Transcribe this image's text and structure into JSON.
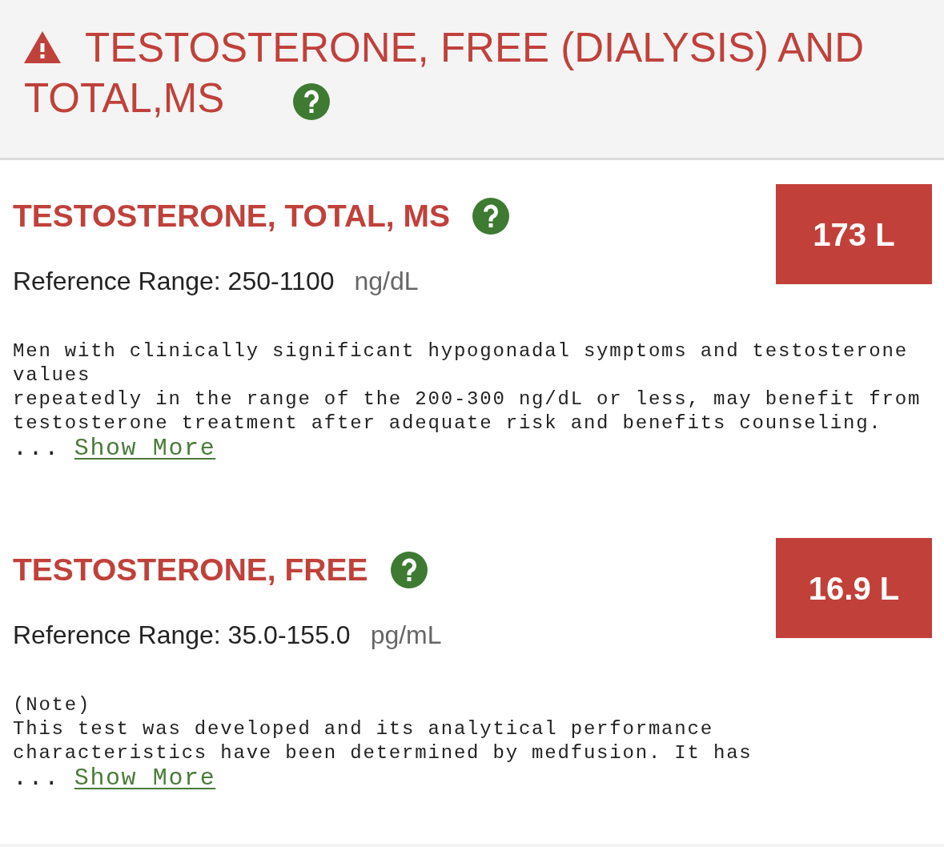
{
  "header": {
    "title_lines": [
      "TESTOSTERONE, FREE (DIALYSIS) AND",
      "TOTAL,MS"
    ],
    "flagged": true
  },
  "results": [
    {
      "name": "TESTOSTERONE, TOTAL, MS",
      "value": "173 L",
      "abnormal": true,
      "reference": "Reference Range: 250-1100",
      "units": "ng/dL",
      "comment": "Men with clinically significant hypogonadal symptoms and testosterone values\nrepeatedly in the range of the 200-300 ng/dL or less, may benefit from\ntestosterone treatment after adequate risk and benefits counseling.",
      "ellipsis": "...",
      "show_more": "Show More"
    },
    {
      "name": "TESTOSTERONE, FREE",
      "value": "16.9 L",
      "abnormal": true,
      "reference": "Reference Range: 35.0-155.0",
      "units": "pg/mL",
      "comment": "(Note)\nThis test was developed and its analytical performance\ncharacteristics have been determined by medfusion. It has",
      "ellipsis": "...",
      "show_more": "Show More"
    }
  ]
}
